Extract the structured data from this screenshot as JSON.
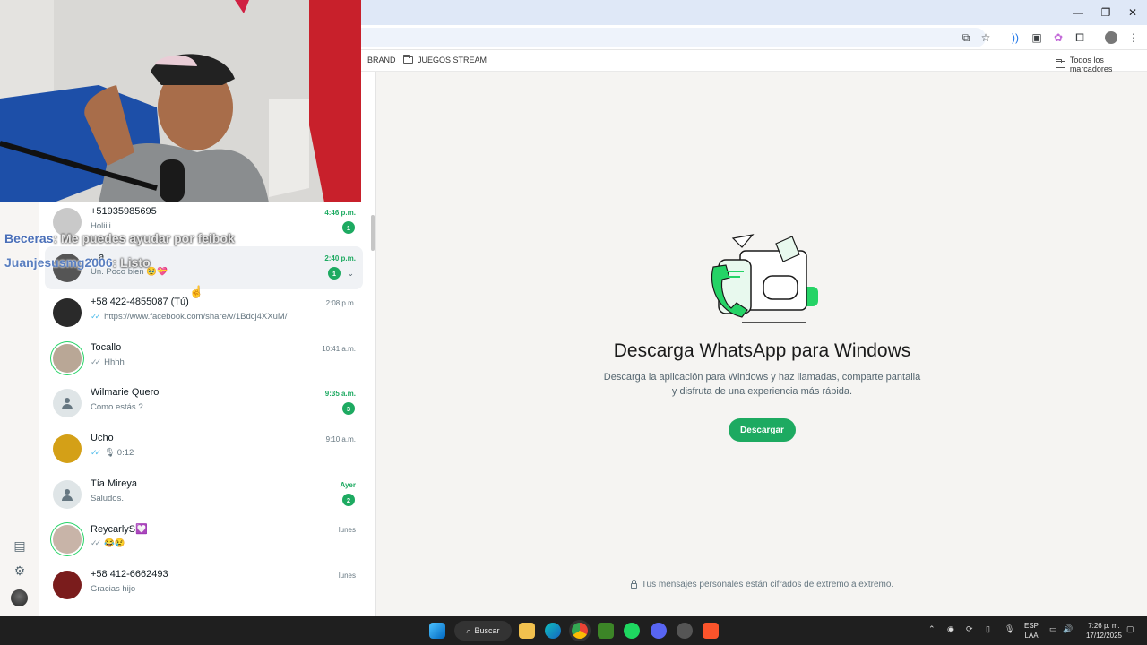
{
  "browser": {
    "window_controls": [
      "—",
      "❐",
      "✕"
    ],
    "bookmarks": [
      {
        "label": "BRAND"
      },
      {
        "label": "JUEGOS STREAM"
      }
    ],
    "all_bookmarks_label": "Todos los marcadores"
  },
  "stream_overlay": {
    "line1_user": "Beceras",
    "line1_text": ": Me puedes ayudar por feibok",
    "line2_user": "Juanjesusmg2006",
    "line2_text": ": Listo"
  },
  "chats": [
    {
      "name": "+51935985695",
      "message": "Holiiii",
      "time": "4:46 p.m.",
      "unread": "1",
      "ticks": false
    },
    {
      "name": "...a",
      "message": "Un. Poco bien 🥹💝",
      "time": "2:40 p.m.",
      "unread": "1",
      "ticks": false
    },
    {
      "name": "+58 422-4855087 (Tú)",
      "message": "https://www.facebook.com/share/v/1Bdcj4XXuM/",
      "time": "2:08 p.m.",
      "unread": "",
      "ticks": true
    },
    {
      "name": "Tocallo",
      "message": "Hhhh",
      "time": "10:41 a.m.",
      "unread": "",
      "ticks": true
    },
    {
      "name": "Wilmarie Quero",
      "message": "Como estás ?",
      "time": "9:35 a.m.",
      "unread": "3",
      "ticks": false
    },
    {
      "name": "Ucho",
      "message": "🎙 0:12",
      "time": "9:10 a.m.",
      "unread": "",
      "ticks": true
    },
    {
      "name": "Tía Mireya",
      "message": "Saludos.",
      "time": "Ayer",
      "unread": "2",
      "ticks": false
    },
    {
      "name": "ReycarlyS💟",
      "message": "😂😢",
      "time": "lunes",
      "unread": "",
      "ticks": true
    },
    {
      "name": "+58 412-6662493",
      "message": "Gracias hijo",
      "time": "lunes",
      "unread": "",
      "ticks": false
    }
  ],
  "promo": {
    "title": "Descarga WhatsApp para Windows",
    "description": "Descarga la aplicación para Windows y haz llamadas, comparte pantalla y disfruta de una experiencia más rápida.",
    "button": "Descargar",
    "encryption_note": "Tus mensajes personales están cifrados de extremo a extremo."
  },
  "taskbar": {
    "search_label": "Buscar",
    "lang_line1": "ESP",
    "lang_line2": "LAA",
    "time": "7:26 p. m.",
    "date": "17/12/2025"
  },
  "colors": {
    "accent_green": "#1daa61",
    "read_tick": "#53bdeb"
  }
}
